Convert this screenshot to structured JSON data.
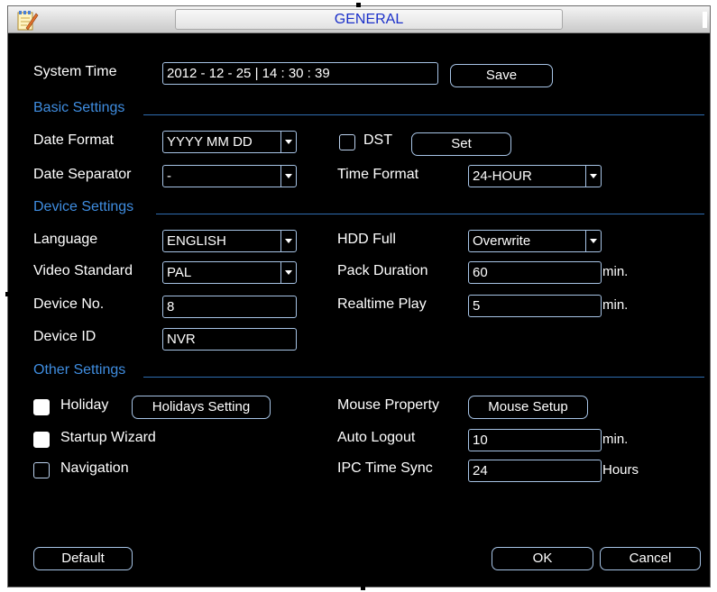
{
  "window": {
    "title": "GENERAL"
  },
  "system_time": {
    "label": "System Time",
    "value": "2012  -  12  -  25  | 14  :  30  :  39",
    "save_label": "Save"
  },
  "sections": {
    "basic": "Basic Settings",
    "device": "Device Settings",
    "other": "Other Settings"
  },
  "basic": {
    "date_format_label": "Date Format",
    "date_format_value": "YYYY MM DD",
    "dst_label": "DST",
    "dst_checked": false,
    "set_label": "Set",
    "date_separator_label": "Date Separator",
    "date_separator_value": "-",
    "time_format_label": "Time Format",
    "time_format_value": "24-HOUR"
  },
  "device": {
    "language_label": "Language",
    "language_value": "ENGLISH",
    "hdd_full_label": "HDD Full",
    "hdd_full_value": "Overwrite",
    "video_standard_label": "Video Standard",
    "video_standard_value": "PAL",
    "pack_duration_label": "Pack Duration",
    "pack_duration_value": "60",
    "pack_duration_unit": "min.",
    "device_no_label": "Device No.",
    "device_no_value": "8",
    "realtime_play_label": "Realtime Play",
    "realtime_play_value": "5",
    "realtime_play_unit": "min.",
    "device_id_label": "Device ID",
    "device_id_value": "NVR"
  },
  "other": {
    "holiday_label": "Holiday",
    "holiday_checked": true,
    "holidays_setting_label": "Holidays Setting",
    "startup_wizard_label": "Startup Wizard",
    "startup_wizard_checked": true,
    "navigation_label": "Navigation",
    "navigation_checked": false,
    "mouse_property_label": "Mouse Property",
    "mouse_setup_label": "Mouse Setup",
    "auto_logout_label": "Auto Logout",
    "auto_logout_value": "10",
    "auto_logout_unit": "min.",
    "ipc_time_sync_label": "IPC Time Sync",
    "ipc_time_sync_value": "24",
    "ipc_time_sync_unit": "Hours"
  },
  "footer": {
    "default_label": "Default",
    "ok_label": "OK",
    "cancel_label": "Cancel"
  },
  "colors": {
    "background": "#000000",
    "section_text": "#3f8de0",
    "title_text": "#1a2fc9",
    "control_border": "#a7c4e6"
  }
}
